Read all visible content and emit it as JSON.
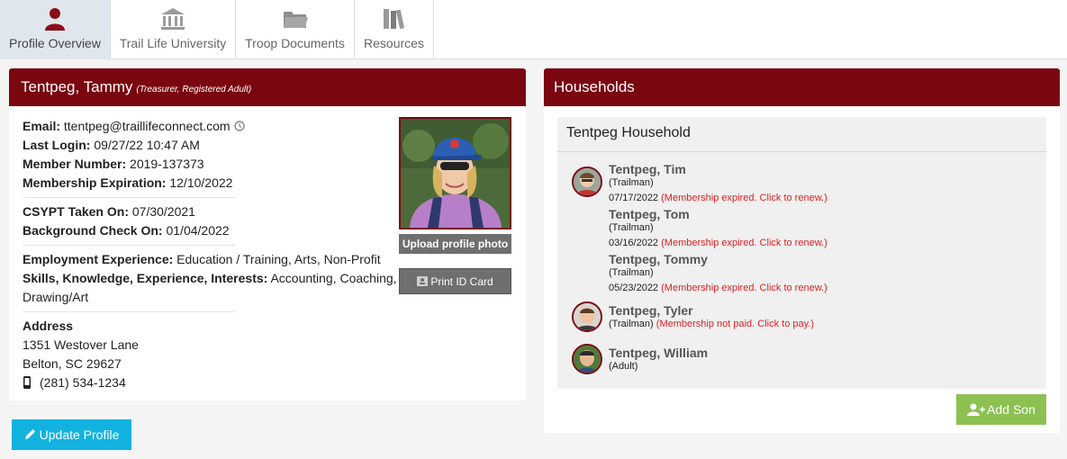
{
  "tabs": [
    {
      "label": "Profile Overview",
      "icon": "person-icon",
      "active": true
    },
    {
      "label": "Trail Life University",
      "icon": "university-icon",
      "active": false
    },
    {
      "label": "Troop Documents",
      "icon": "folder-icon",
      "active": false
    },
    {
      "label": "Resources",
      "icon": "books-icon",
      "active": false
    }
  ],
  "profile": {
    "name": "Tentpeg, Tammy",
    "roles": "(Treasurer, Registered Adult)",
    "email_label": "Email:",
    "email": "ttentpeg@traillifeconnect.com",
    "last_login_label": "Last Login:",
    "last_login": "09/27/22 10:47 AM",
    "member_number_label": "Member Number:",
    "member_number": "2019-137373",
    "membership_exp_label": "Membership Expiration:",
    "membership_exp": "12/10/2022",
    "csypt_label": "CSYPT Taken On:",
    "csypt": "07/30/2021",
    "bg_check_label": "Background Check On:",
    "bg_check": "01/04/2022",
    "employment_label": "Employment Experience:",
    "employment": "Education / Training, Arts, Non-Profit",
    "skills_label": "Skills, Knowledge, Experience, Interests:",
    "skills_1": "Accounting, Coaching,",
    "skills_2": "Drawing/Art",
    "address_label": "Address",
    "address_line1": "1351 Westover Lane",
    "address_line2": "Belton, SC 29627",
    "phone": "(281) 534-1234",
    "upload_photo": "Upload profile photo",
    "print_id": "Print ID Card",
    "update_profile": "Update Profile"
  },
  "households": {
    "title": "Households",
    "household_name": "Tentpeg Household",
    "members": [
      {
        "name": "Tentpeg, Tim",
        "role": "(Trailman)",
        "date": "07/17/2022",
        "status": "(Membership expired. Click to renew.)"
      },
      {
        "name": "Tentpeg, Tom",
        "role": "(Trailman)",
        "date": "03/16/2022",
        "status": "(Membership expired. Click to renew.)"
      },
      {
        "name": "Tentpeg, Tommy",
        "role": "(Trailman)",
        "date": "05/23/2022",
        "status": "(Membership expired. Click to renew.)"
      },
      {
        "name": "Tentpeg, Tyler",
        "role": "(Trailman)",
        "status": "(Membership not paid. Click to pay.)"
      },
      {
        "name": "Tentpeg, William",
        "role": "(Adult)"
      }
    ],
    "add_son": "Add Son"
  },
  "colors": {
    "header_maroon": "#7a0610",
    "update_blue": "#12b2e0",
    "add_son_green": "#8cc152",
    "warning_red": "#e02020"
  }
}
